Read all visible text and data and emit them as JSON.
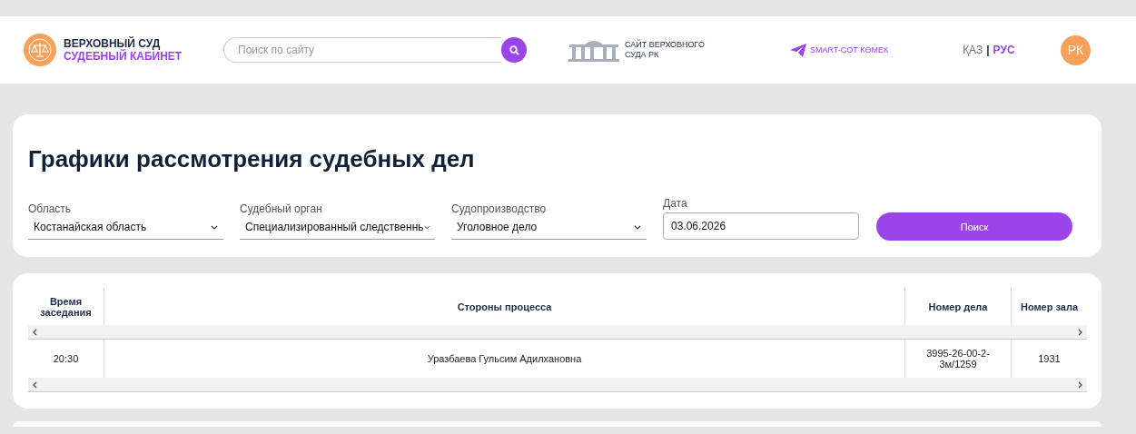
{
  "header": {
    "brand_line_1": "ВЕРХОВНЫЙ СУД",
    "brand_line_2": "СУДЕБНЫЙ КАБИНЕТ",
    "search": {
      "placeholder": "Поиск по сайту"
    },
    "court_site_link": "САЙТ ВЕРХОВНОГО СУДА РК",
    "smart_link": "SMART-СОТ КӨМЕК",
    "languages": [
      {
        "label": "ҚАЗ",
        "selected": false
      },
      {
        "label": "РУС",
        "selected": true
      }
    ],
    "language_separator": "|",
    "avatar": "РК"
  },
  "page_title": "Графики рассмотрения судебных дел",
  "filters": [
    {
      "label": "Область",
      "value": "Костанайская область",
      "kind": "dropdown"
    },
    {
      "label": "Судебный орган",
      "value": "Специализированный следственнь",
      "kind": "dropdown"
    },
    {
      "label": "Судопроизводство",
      "value": "Уголовное дело",
      "kind": "dropdown"
    },
    {
      "label": "Дата",
      "value": "03.06.2026",
      "kind": "date"
    }
  ],
  "search_button": "Поиск",
  "table": {
    "columns": [
      "Время заседания",
      "Стороны процесса",
      "Номер дела",
      "Номер зала"
    ],
    "rows": [
      [
        "20:30",
        "Уразбаева Гульсим Адилхановна",
        "3995-26-00-2-3м/1259",
        "1931"
      ]
    ]
  }
}
